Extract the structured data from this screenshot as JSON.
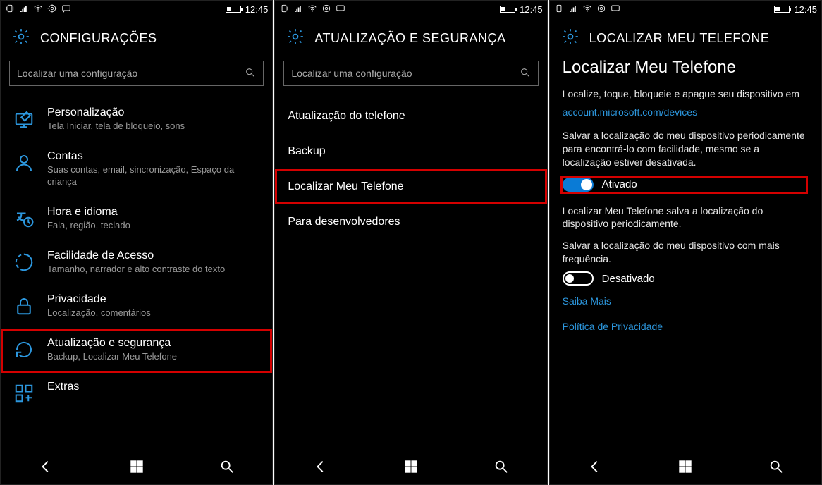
{
  "statusbar": {
    "clock": "12:45"
  },
  "screen1": {
    "title": "CONFIGURAÇÕES",
    "search_placeholder": "Localizar uma configuração",
    "items": [
      {
        "title": "Personalização",
        "desc": "Tela Iniciar, tela de bloqueio, sons"
      },
      {
        "title": "Contas",
        "desc": "Suas contas, email, sincronização, Espaço da criança"
      },
      {
        "title": "Hora e idioma",
        "desc": "Fala, região, teclado"
      },
      {
        "title": "Facilidade de Acesso",
        "desc": "Tamanho, narrador e alto contraste do texto"
      },
      {
        "title": "Privacidade",
        "desc": "Localização, comentários"
      },
      {
        "title": "Atualização e segurança",
        "desc": "Backup, Localizar Meu Telefone"
      },
      {
        "title": "Extras",
        "desc": ""
      }
    ]
  },
  "screen2": {
    "title": "ATUALIZAÇÃO E SEGURANÇA",
    "search_placeholder": "Localizar uma configuração",
    "items": [
      "Atualização do telefone",
      "Backup",
      "Localizar Meu Telefone",
      "Para desenvolvedores"
    ]
  },
  "screen3": {
    "title": "LOCALIZAR MEU TELEFONE",
    "heading": "Localizar Meu Telefone",
    "intro": "Localize, toque, bloqueie e apague seu dispositivo em",
    "link": "account.microsoft.com/devices",
    "save_text": "Salvar a localização do meu dispositivo periodicamente para encontrá-lo com facilidade, mesmo se a localização estiver desativada.",
    "toggle1_label": "Ativado",
    "note": "Localizar Meu Telefone salva a localização do dispositivo periodicamente.",
    "freq_text": "Salvar a localização do meu dispositivo com mais frequência.",
    "toggle2_label": "Desativado",
    "learn_more": "Saiba Mais",
    "privacy_link": "Política de Privacidade"
  }
}
